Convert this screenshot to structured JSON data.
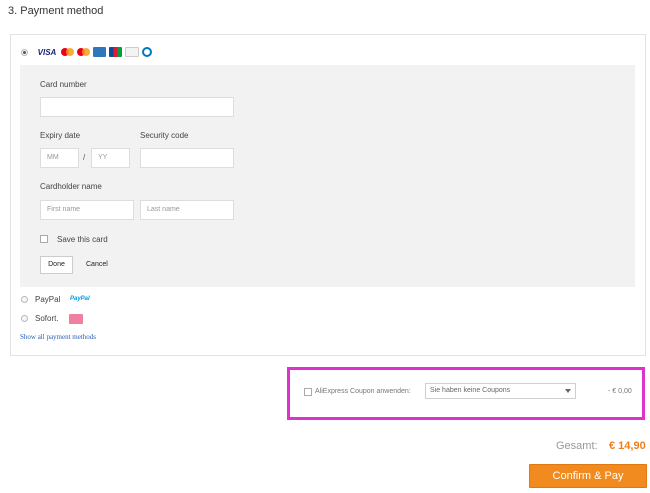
{
  "section_title": "3. Payment method",
  "card_method": {
    "selected": true,
    "logos": [
      "visa-logo",
      "mastercard-logo",
      "maestro-logo",
      "amex-logo",
      "jcb-logo",
      "discover-logo",
      "diners-logo"
    ],
    "visa_text": "VISA",
    "card_number_label": "Card number",
    "card_number_value": "",
    "expiry_label": "Expiry date",
    "expiry_mm_placeholder": "MM",
    "expiry_separator": "/",
    "expiry_yy_placeholder": "YY",
    "security_label": "Security code",
    "cardholder_label": "Cardholder name",
    "first_name_placeholder": "First name",
    "last_name_placeholder": "Last name",
    "save_card_label": "Save this card",
    "done_label": "Done",
    "cancel_label": "Cancel"
  },
  "other_methods": {
    "paypal_label": "PayPal",
    "paypal_logo_text": "PayPal",
    "sofort_label": "Sofort.",
    "show_all_label": "Show all payment methods"
  },
  "coupon": {
    "label": "AliExpress Coupon anwenden:",
    "select_value": "Sie haben keine Coupons",
    "discount": "- € 0,00",
    "highlight_color": "#dd33cc"
  },
  "summary": {
    "total_label": "Gesamt:",
    "total_value": "€ 14,90",
    "pay_button": "Confirm & Pay",
    "accent_color": "#f28b1f"
  }
}
